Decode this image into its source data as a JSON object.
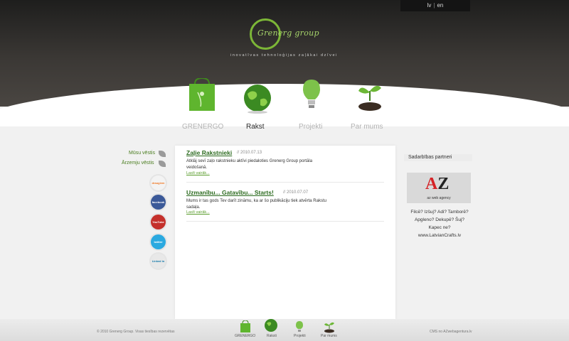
{
  "header": {
    "languages": [
      "lv",
      "en"
    ],
    "logo_text": "Grenerg group",
    "tagline": "inovatīvas tehnoloģijas zaļākai dzīvei"
  },
  "nav": [
    {
      "label": "GRENERGO",
      "icon": "shopping-bag-icon"
    },
    {
      "label": "Rakst",
      "icon": "globe-icon",
      "active": true
    },
    {
      "label": "Projekti",
      "icon": "lightbulb-icon"
    },
    {
      "label": "Par mums",
      "icon": "sprout-icon"
    }
  ],
  "sidebar": {
    "links": [
      "Mūsu vēstis",
      "Ārzemju vēstis"
    ],
    "social": [
      {
        "name": "draugiem",
        "color": "#f07a27"
      },
      {
        "name": "facebook",
        "color": "#3b5998"
      },
      {
        "name": "YouTube",
        "color": "#c4302b"
      },
      {
        "name": "twitter",
        "color": "#2aa9e0"
      },
      {
        "name": "Linked in",
        "color": "#0e76a8"
      }
    ]
  },
  "articles": [
    {
      "title": "Zaļie Rakstnieki",
      "date": "// 2010.07.13",
      "body": "Atklāj sevī zaļo rakstnieku aktīvi piedaloties Grenerg Group portāla veidošanā.",
      "read_more": "Lasīt vairāk..."
    },
    {
      "title": "Uzmanību... Gatavību... Starts!",
      "date": "// 2010.07.07",
      "body": "Mums ir tas gods Tev darīt zināmu, ka ar šo publikāciju tiek atvērta Rakstu sadaļa.",
      "read_more": "Lasīt vairāk..."
    }
  ],
  "partners": {
    "title": "Sadarbības partneri",
    "az_text": "az web agency",
    "craft_lines": [
      "Filcē? Izšuj? Adi? Tamborē?",
      "Apgleno? Dekupē? Šuj?",
      "Kapec ne?",
      "www.LatvianCrafts.lv"
    ]
  },
  "footer": {
    "copyright": "© 2010 Grenerg Group. Visas tiesības rezervētas",
    "cms": "CMS no AZwebagentura.lv",
    "nav": [
      "GRENERGO",
      "Raksti",
      "Projekti",
      "Par mums"
    ]
  }
}
